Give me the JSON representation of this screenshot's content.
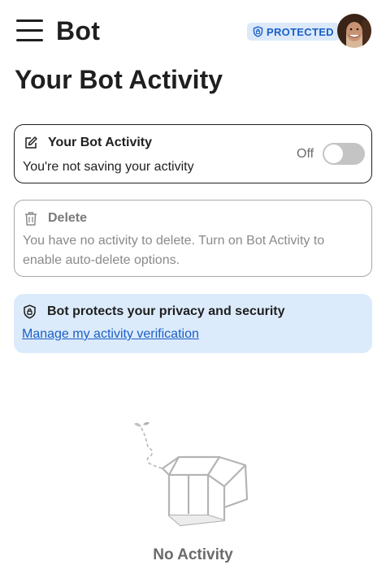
{
  "header": {
    "title": "Bot",
    "badge": "PROTECTED"
  },
  "page": {
    "title": "Your Bot Activity"
  },
  "activity_card": {
    "heading": "Your Bot Activity",
    "description": "You're not saving your activity",
    "toggle_label": "Off",
    "toggle_on": false
  },
  "delete_card": {
    "heading": "Delete",
    "description_line1": "You have no activity to delete. Turn on Bot Activity to",
    "description_line2": "enable auto-delete options."
  },
  "privacy_card": {
    "heading": "Bot protects your privacy and security",
    "link": "Manage my activity verification"
  },
  "empty_state": {
    "label": "No Activity"
  },
  "colors": {
    "accent": "#1a5fc7",
    "badge_bg": "#dbe9fb",
    "privacy_bg": "#dcebfb",
    "toggle_off": "#c4c4c4"
  }
}
